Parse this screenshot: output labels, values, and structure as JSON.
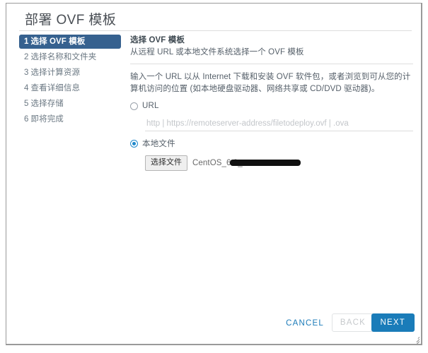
{
  "window": {
    "title": "部署 OVF 模板"
  },
  "steps": [
    {
      "num": "1",
      "label": "选择 OVF 模板",
      "active": true
    },
    {
      "num": "2",
      "label": "选择名称和文件夹",
      "active": false
    },
    {
      "num": "3",
      "label": "选择计算资源",
      "active": false
    },
    {
      "num": "4",
      "label": "查看详细信息",
      "active": false
    },
    {
      "num": "5",
      "label": "选择存储",
      "active": false
    },
    {
      "num": "6",
      "label": "即将完成",
      "active": false
    }
  ],
  "content": {
    "section_title": "选择 OVF 模板",
    "section_subtitle": "从远程 URL 或本地文件系统选择一个 OVF 模板",
    "description": "输入一个 URL 以从 Internet 下载和安装 OVF 软件包，或者浏览到可从您的计算机访问的位置 (如本地硬盘驱动器、网络共享或 CD/DVD 驱动器)。",
    "url_option": {
      "label": "URL",
      "selected": false,
      "input_value": "",
      "input_placeholder": "http | https://remoteserver-address/filetodeploy.ovf | .ova"
    },
    "local_option": {
      "label": "本地文件",
      "selected": true,
      "button_label": "选择文件",
      "file_name": "CentOS_6.8_                       .ova"
    }
  },
  "footer": {
    "cancel_label": "CANCEL",
    "back_label": "BACK",
    "next_label": "NEXT"
  },
  "colors": {
    "accent_blue": "#1a7cb9",
    "active_step_bg": "#36618f",
    "radio_selected": "#2189cb",
    "text_primary": "#3f4a52",
    "text_secondary": "#56606a",
    "placeholder": "#c3c6ca"
  }
}
